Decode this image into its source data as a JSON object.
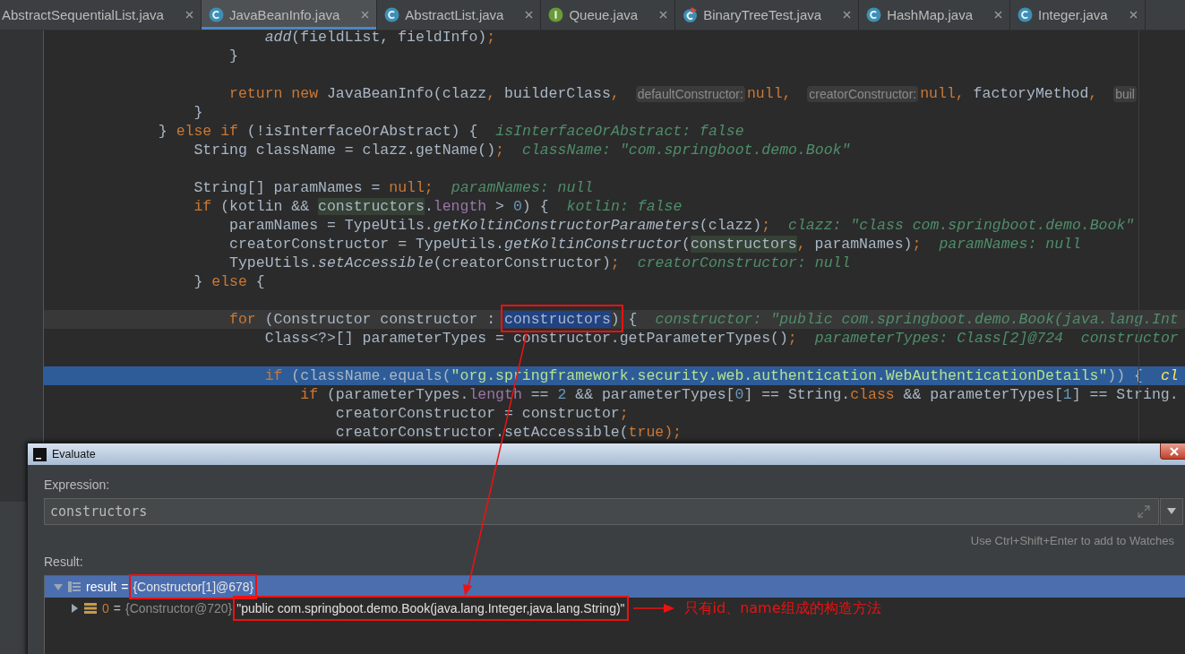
{
  "tabs": [
    {
      "label": "AbstractSequentialList.java",
      "kind": "file",
      "selected": false
    },
    {
      "label": "JavaBeanInfo.java",
      "kind": "class",
      "selected": true
    },
    {
      "label": "AbstractList.java",
      "kind": "class",
      "selected": false
    },
    {
      "label": "Queue.java",
      "kind": "interface",
      "selected": false
    },
    {
      "label": "BinaryTreeTest.java",
      "kind": "test",
      "selected": false
    },
    {
      "label": "HashMap.java",
      "kind": "class",
      "selected": false
    },
    {
      "label": "Integer.java",
      "kind": "class",
      "selected": false
    }
  ],
  "code": {
    "lines": [
      {
        "selected": false,
        "current": false,
        "segs": [
          {
            "t": "                        add",
            "kind": "method"
          },
          {
            "t": "(fieldList, fieldInfo)",
            "kind": "plain"
          },
          {
            "t": ";",
            "kind": "kw"
          }
        ]
      },
      {
        "selected": false,
        "current": false,
        "segs": [
          {
            "t": "                    }",
            "kind": "plain"
          }
        ]
      },
      {
        "selected": false,
        "current": false
      },
      {
        "selected": false,
        "current": false,
        "segs": [
          {
            "t": "                    return new ",
            "kind": "kw"
          },
          {
            "t": "JavaBeanInfo(clazz",
            "kind": "plain"
          },
          {
            "t": ", ",
            "kind": "kw"
          },
          {
            "t": "builderClass",
            "kind": "plain"
          },
          {
            "t": ", ",
            "kind": "kw"
          },
          {
            "t": "defaultConstructor:",
            "kind": "pill"
          },
          {
            "t": "null, ",
            "kind": "kw"
          },
          {
            "t": "creatorConstructor:",
            "kind": "pill"
          },
          {
            "t": "null, ",
            "kind": "kw"
          },
          {
            "t": "factoryMethod",
            "kind": "plain"
          },
          {
            "t": ", ",
            "kind": "kw"
          },
          {
            "t": "buil",
            "kind": "pill"
          }
        ]
      },
      {
        "selected": false,
        "current": false,
        "segs": [
          {
            "t": "                }",
            "kind": "plain"
          }
        ]
      },
      {
        "selected": false,
        "current": false,
        "segs": [
          {
            "t": "            } ",
            "kind": "plain"
          },
          {
            "t": "else if ",
            "kind": "kw"
          },
          {
            "t": "(!isInterfaceOrAbstract) {",
            "kind": "plain"
          },
          {
            "t": "isInterfaceOrAbstract: false",
            "kind": "hint"
          }
        ]
      },
      {
        "selected": false,
        "current": false,
        "segs": [
          {
            "t": "                String className = clazz.getName()",
            "kind": "plain"
          },
          {
            "t": ";",
            "kind": "kw"
          },
          {
            "t": "className: \"com.springboot.demo.Book\"",
            "kind": "hint"
          }
        ]
      },
      {
        "selected": false,
        "current": false
      },
      {
        "selected": false,
        "current": false,
        "segs": [
          {
            "t": "                String[] paramNames = ",
            "kind": "plain"
          },
          {
            "t": "null;",
            "kind": "kw"
          },
          {
            "t": "paramNames: null",
            "kind": "hint"
          }
        ]
      },
      {
        "selected": false,
        "current": false,
        "segs": [
          {
            "t": "                if ",
            "kind": "kw"
          },
          {
            "t": "(kotlin && ",
            "kind": "plain"
          },
          {
            "t": "constructors",
            "kind": "usage"
          },
          {
            "t": ".",
            "kind": "plain"
          },
          {
            "t": "length",
            "kind": "field"
          },
          {
            "t": " > ",
            "kind": "plain"
          },
          {
            "t": "0",
            "kind": "num"
          },
          {
            "t": ") {",
            "kind": "plain"
          },
          {
            "t": "kotlin: false",
            "kind": "hint"
          }
        ]
      },
      {
        "selected": false,
        "current": false,
        "segs": [
          {
            "t": "                    paramNames = TypeUtils.",
            "kind": "plain"
          },
          {
            "t": "getKoltinConstructorParameters",
            "kind": "method"
          },
          {
            "t": "(clazz)",
            "kind": "plain"
          },
          {
            "t": ";",
            "kind": "kw"
          },
          {
            "t": "clazz: \"class com.springboot.demo.Book\"",
            "kind": "hint"
          }
        ]
      },
      {
        "selected": false,
        "current": false,
        "segs": [
          {
            "t": "                    creatorConstructor = TypeUtils.",
            "kind": "plain"
          },
          {
            "t": "getKoltinConstructor",
            "kind": "method"
          },
          {
            "t": "(",
            "kind": "plain"
          },
          {
            "t": "constructors",
            "kind": "usage"
          },
          {
            "t": ", ",
            "kind": "kw"
          },
          {
            "t": "paramNames)",
            "kind": "plain"
          },
          {
            "t": ";",
            "kind": "kw"
          },
          {
            "t": "paramNames: null",
            "kind": "hint"
          }
        ]
      },
      {
        "selected": false,
        "current": false,
        "segs": [
          {
            "t": "                    TypeUtils.",
            "kind": "plain"
          },
          {
            "t": "setAccessible",
            "kind": "method"
          },
          {
            "t": "(creatorConstructor)",
            "kind": "plain"
          },
          {
            "t": ";",
            "kind": "kw"
          },
          {
            "t": "creatorConstructor: null",
            "kind": "hint"
          }
        ]
      },
      {
        "selected": false,
        "current": false,
        "segs": [
          {
            "t": "                } ",
            "kind": "plain"
          },
          {
            "t": "else ",
            "kind": "kw"
          },
          {
            "t": "{",
            "kind": "plain"
          }
        ]
      },
      {
        "selected": false,
        "current": false
      },
      {
        "selected": false,
        "current": true,
        "segs": [
          {
            "t": "                    for ",
            "kind": "kw"
          },
          {
            "t": "(Constructor constructor : ",
            "kind": "plain"
          },
          {
            "t": "constructors",
            "kind": "sel",
            "boxed": true
          },
          {
            "t": ")",
            "kind": "plain",
            "boxed": true
          },
          {
            "t": " {",
            "kind": "plain"
          },
          {
            "t": "constructor: \"public com.springboot.demo.Book(java.lang.Int",
            "kind": "hint"
          }
        ]
      },
      {
        "selected": false,
        "current": false,
        "segs": [
          {
            "t": "                        Class<?>[] parameterTypes = constructor.getParameterTypes()",
            "kind": "plain"
          },
          {
            "t": ";",
            "kind": "kw"
          },
          {
            "t": "parameterTypes: Class[2]@724  constructor",
            "kind": "hint"
          }
        ]
      },
      {
        "selected": false,
        "current": false
      },
      {
        "selected": true,
        "current": false,
        "segs": [
          {
            "t": "                        if ",
            "kind": "kw"
          },
          {
            "t": "(className.equals(",
            "kind": "plain"
          },
          {
            "t": "\"org.springframework.security.web.authentication.WebAuthenticationDetails\"",
            "kind": "str"
          },
          {
            "t": ")) {",
            "kind": "plain"
          },
          {
            "t": "cl",
            "kind": "hint"
          }
        ]
      },
      {
        "selected": false,
        "current": false,
        "segs": [
          {
            "t": "                            if ",
            "kind": "kw"
          },
          {
            "t": "(parameterTypes.",
            "kind": "plain"
          },
          {
            "t": "length",
            "kind": "field"
          },
          {
            "t": " == ",
            "kind": "plain"
          },
          {
            "t": "2",
            "kind": "num"
          },
          {
            "t": " && parameterTypes[",
            "kind": "plain"
          },
          {
            "t": "0",
            "kind": "num"
          },
          {
            "t": "] == String.",
            "kind": "plain"
          },
          {
            "t": "class",
            "kind": "kw"
          },
          {
            "t": " && parameterTypes[",
            "kind": "plain"
          },
          {
            "t": "1",
            "kind": "num"
          },
          {
            "t": "] == String.",
            "kind": "plain"
          }
        ]
      },
      {
        "selected": false,
        "current": false,
        "segs": [
          {
            "t": "                                creatorConstructor = constructor",
            "kind": "plain"
          },
          {
            "t": ";",
            "kind": "kw"
          }
        ]
      },
      {
        "selected": false,
        "current": false,
        "segs": [
          {
            "t": "                                creatorConstructor.setAccessible(",
            "kind": "plain"
          },
          {
            "t": "true",
            "kind": "kw"
          },
          {
            "t": ");",
            "kind": "kw"
          }
        ]
      }
    ]
  },
  "evaluate_dialog": {
    "title": "Evaluate",
    "expression_label": "Expression:",
    "expression": "constructors",
    "watch_hint": "Use Ctrl+Shift+Enter to add to Watches",
    "result_label": "Result:",
    "result_tree": [
      {
        "name": "result",
        "separator": "=",
        "type": "{Constructor[1]@678}",
        "type_boxed": true,
        "kind": "array",
        "expanded": true,
        "selected": true,
        "children": [
          {
            "name": "0",
            "separator": "=",
            "type": "{Constructor@720}",
            "type_boxed": false,
            "value": "\"public com.springboot.demo.Book(java.lang.Integer,java.lang.String)\"",
            "value_boxed": true,
            "kind": "field",
            "expanded": false,
            "selected": false,
            "note": "只有id、name组成的构造方法"
          }
        ]
      }
    ]
  }
}
